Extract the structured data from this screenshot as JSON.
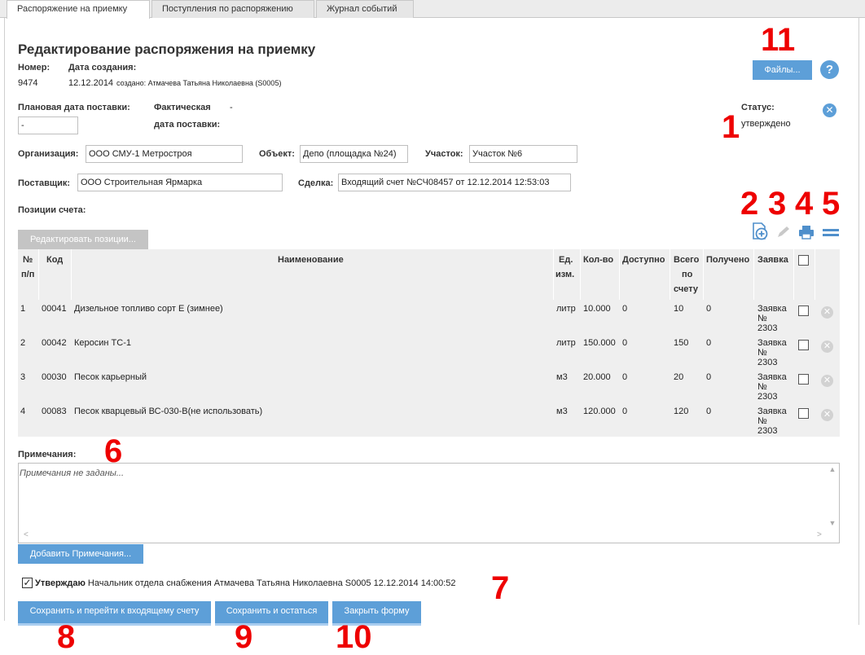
{
  "tabs": [
    "Распоряжение на приемку",
    "Поступления по распоряжению",
    "Журнал событий"
  ],
  "page_title": "Редактирование распоряжения на приемку",
  "number": {
    "label": "Номер:",
    "value": "9474"
  },
  "created": {
    "label": "Дата создания:",
    "date": "12.12.2014",
    "by": "создано: Атмачева Татьяна Николаевна (S0005)"
  },
  "planned_date": {
    "label": "Плановая дата поставки:",
    "value": "-"
  },
  "actual_date": {
    "label_line1": "Фактическая",
    "label_line2": "дата поставки:",
    "value": "-"
  },
  "status": {
    "label": "Статус:",
    "value": "утверждено"
  },
  "files_button": "Файлы...",
  "help_icon": "?",
  "organization": {
    "label": "Организация:",
    "value": "ООО СМУ-1 Метростроя"
  },
  "object": {
    "label": "Объект:",
    "value": "Депо (площадка №24)"
  },
  "section": {
    "label": "Участок:",
    "value": "Участок №6"
  },
  "supplier": {
    "label": "Поставщик:",
    "value": "ООО Строительная Ярмарка"
  },
  "deal": {
    "label": "Сделка:",
    "value": "Входящий счет №СЧ08457 от 12.12.2014 12:53:03"
  },
  "positions_label": "Позиции счета:",
  "edit_positions_button": "Редактировать позиции...",
  "table": {
    "headers": {
      "num_1": "№",
      "num_2": "п/п",
      "code": "Код",
      "name": "Наименование",
      "unit_1": "Ед.",
      "unit_2": "изм.",
      "qty": "Кол-во",
      "available": "Доступно",
      "total_1": "Всего",
      "total_2": "по",
      "total_3": "счету",
      "received": "Получено",
      "request": "Заявка"
    },
    "rows": [
      {
        "n": "1",
        "code": "00041",
        "name": "Дизельное топливо сорт Е (зимнее)",
        "unit": "литр",
        "qty": "10.000",
        "avail": "0",
        "total": "10",
        "recv": "0",
        "req1": "Заявка",
        "req2": "№",
        "req3": "2303"
      },
      {
        "n": "2",
        "code": "00042",
        "name": "Керосин ТС-1",
        "unit": "литр",
        "qty": "150.000",
        "avail": "0",
        "total": "150",
        "recv": "0",
        "req1": "Заявка",
        "req2": "№",
        "req3": "2303"
      },
      {
        "n": "3",
        "code": "00030",
        "name": "Песок карьерный",
        "unit": "м3",
        "qty": "20.000",
        "avail": "0",
        "total": "20",
        "recv": "0",
        "req1": "Заявка",
        "req2": "№",
        "req3": "2303"
      },
      {
        "n": "4",
        "code": "00083",
        "name": "Песок кварцевый ВС-030-В(не использовать)",
        "unit": "м3",
        "qty": "120.000",
        "avail": "0",
        "total": "120",
        "recv": "0",
        "req1": "Заявка",
        "req2": "№",
        "req3": "2303"
      }
    ]
  },
  "notes": {
    "label": "Примечания:",
    "placeholder": "Примечания не заданы..."
  },
  "add_notes_button": "Добавить Примечания...",
  "approve": {
    "label": "Утверждаю",
    "text": "Начальник отдела снабжения Атмачева Татьяна Николаевна S0005 12.12.2014 14:00:52",
    "checked": true
  },
  "buttons": {
    "save_go": "Сохранить и перейти к входящему счету",
    "save_stay": "Сохранить и остаться",
    "close": "Закрыть форму"
  },
  "callouts": [
    "1",
    "2",
    "3",
    "4",
    "5",
    "6",
    "7",
    "8",
    "9",
    "10",
    "11"
  ],
  "colors": {
    "accent": "#5d9fd8",
    "callout": "#ee0000",
    "table_bg": "#efefef"
  }
}
